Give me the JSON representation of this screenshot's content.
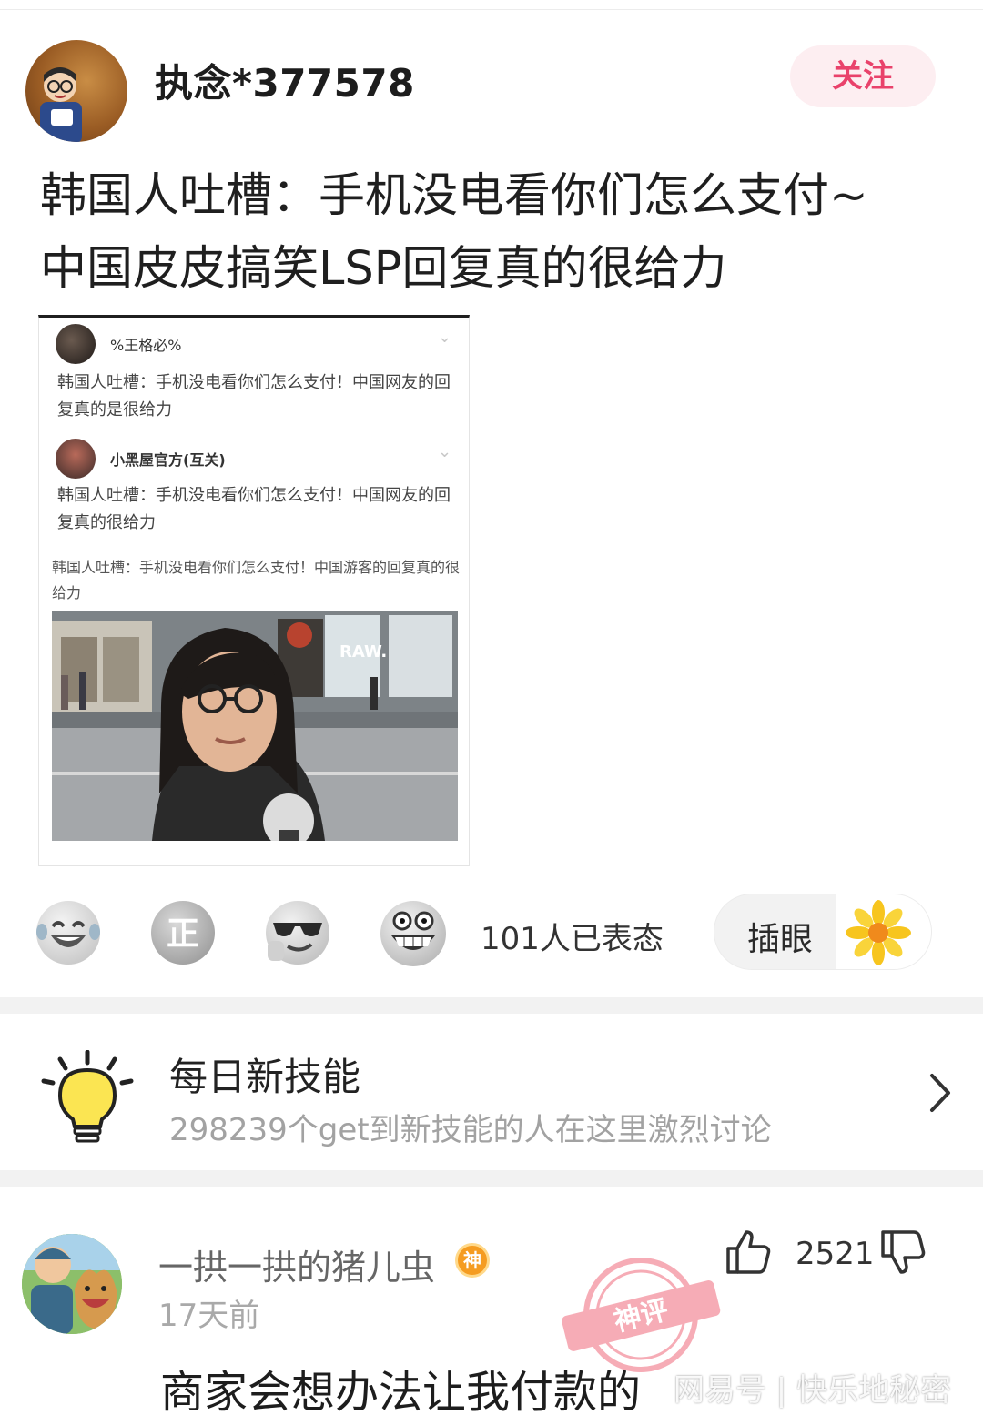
{
  "author": {
    "name": "执念*377578",
    "follow_label": "关注"
  },
  "post": {
    "title_line1": "韩国人吐槽：手机没电看你们怎么支付~",
    "title_line2": "中国皮皮搞笑LSP回复真的很给力"
  },
  "embed": {
    "comment1_user": "%王格必%",
    "comment1_text": "韩国人吐槽：手机没电看你们怎么支付！中国网友的回复真的是很给力",
    "comment2_user": "小黑屋官方(互关)",
    "comment2_text": "韩国人吐槽：手机没电看你们怎么支付！中国网友的回复真的很给力",
    "caption": "韩国人吐槽：手机没电看你们怎么支付！中国游客的回复真的很给力",
    "billboard_text": "RAW."
  },
  "reactions": {
    "count_text": "101人已表态",
    "emoji_icons": [
      "laughing-tears-icon",
      "zheng-icon",
      "cool-sunglasses-icon",
      "grinning-teeth-icon"
    ],
    "tag_label": "插眼",
    "tag_icon": "sunflower-icon"
  },
  "topic": {
    "title": "每日新技能",
    "subtitle": "298239个get到新技能的人在这里激烈讨论",
    "icon": "lightbulb-icon"
  },
  "comment": {
    "username": "一拱一拱的猪儿虫",
    "badge": "神",
    "time": "17天前",
    "like_count": "2521",
    "body": "商家会想办法让我付款的",
    "stamp_text": "神评",
    "watermark": "网易号 | 快乐地秘密"
  },
  "colors": {
    "accent_pink": "#e9426b",
    "follow_bg": "#fdeef1",
    "badge_orange": "#f59c21"
  }
}
